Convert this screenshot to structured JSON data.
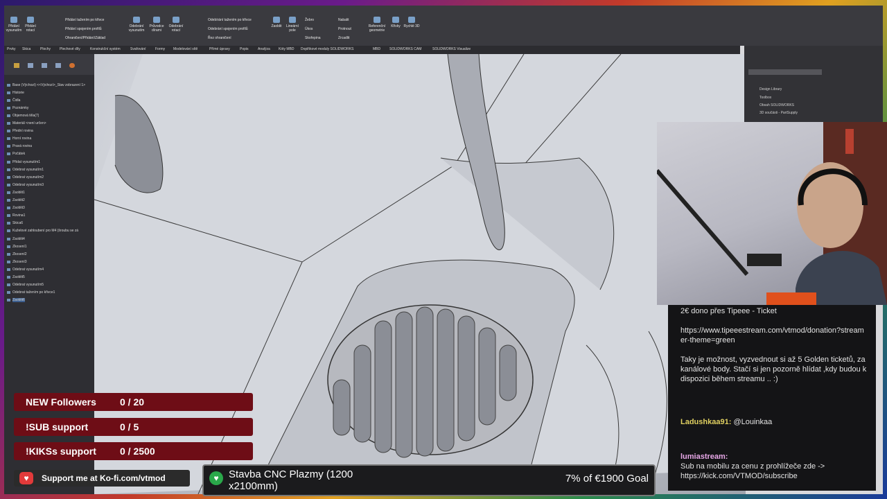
{
  "ribbon": {
    "buttons": [
      "Přidání vysunutím",
      "Přidání rotací",
      "Přidání tažením po křivce",
      "Přidání spojením profilů",
      "Ohraničení/Přidání/Základ",
      "Odebrání vysunutím",
      "Průvodce dírami",
      "Odebrání rotací",
      "Odebírání tažením po křivce",
      "Odebrání spojením profilů",
      "Řez ohraničení",
      "Zaoblit",
      "Lineární pole",
      "Žebro",
      "Úkos",
      "Skořepina",
      "Nabalit",
      "Protnout",
      "Zrcadlit",
      "Referenční geometrie",
      "Křivky",
      "Rychlé 3D"
    ]
  },
  "command_tabs": [
    "Prvky",
    "Skica",
    "Plochy",
    "Plechové díly",
    "Konstrukční systém",
    "Svařování",
    "Formy",
    "Modelování sítě",
    "Přímé úpravy",
    "Popis",
    "Analýza",
    "Kóty MBD",
    "Doplňkové moduly SOLIDWORKS",
    "MBD",
    "SOLIDWORKS CAM",
    "SOLIDWORKS Visualize"
  ],
  "tree": {
    "items": [
      "Base (Výchozí) <<Výchozí>_Stav zobrazení 1>",
      "Historie",
      "Čidla",
      "Poznámky",
      "Objemová těla(7)",
      "Materiál <není určen>",
      "Přední rovina",
      "Horní rovina",
      "Pravá rovina",
      "Počátek",
      "Přidat vysunutím1",
      "Odebrat vysunutím1",
      "Odebrat vysunutím2",
      "Odebrat vysunutím3",
      "Zaoblit1",
      "Zaoblit2",
      "Zaoblit3",
      "Rovina1",
      "Skica6",
      "Kuželové zahloubení pro M4 (šroubu se zá",
      "Zaoblit4",
      "Zkosení1",
      "Zkosení2",
      "Zkosení3",
      "Odebrat vysunutím4",
      "Zaoblit5",
      "Odebrat vysunutím5",
      "Odebrat tažením po křivce1",
      "Zaoblit6"
    ]
  },
  "taskpane": {
    "search_placeholder": "Hledat v Toolbox",
    "items": [
      "Design Library",
      "Toolbox",
      "Obsah SOLIDWORKS",
      "3D součásti - PartSupply"
    ]
  },
  "chat": {
    "messages": [
      {
        "text": "2€ dono přes Tipeee - Ticket"
      },
      {
        "text": "https://www.tipeeestream.com/vtmod/donation?streamer-theme=green"
      },
      {
        "text": "Taky je možnost, vyzvednout si až 5 Golden ticketů, za kanálové body. Stačí si jen pozorně hlídat ,kdy budou k dispozici během streamu .. :)"
      },
      {
        "user": "Ladushkaa91:",
        "text": "@Louinkaa"
      },
      {
        "user": "lumiastream:",
        "text": "Sub na mobilu za cenu z prohlížeče zde -> https://kick.com/VTMOD/subscribe"
      }
    ]
  },
  "goals": [
    {
      "label": "NEW Followers",
      "count": "0 / 20"
    },
    {
      "label": "!SUB support",
      "count": "0 / 5"
    },
    {
      "label": "!KIKSs support",
      "count": "0 / 2500"
    }
  ],
  "kofi": {
    "text": "Support me at Ko-fi.com/vtmod"
  },
  "donation_goal": {
    "title": "Stavba CNC Plazmy (1200 x2100mm)",
    "percent": "7% of €1900 Goal",
    "progress": 0.07
  },
  "colors": {
    "goal_bar": "#6e0d16",
    "accent": "#e03030"
  }
}
